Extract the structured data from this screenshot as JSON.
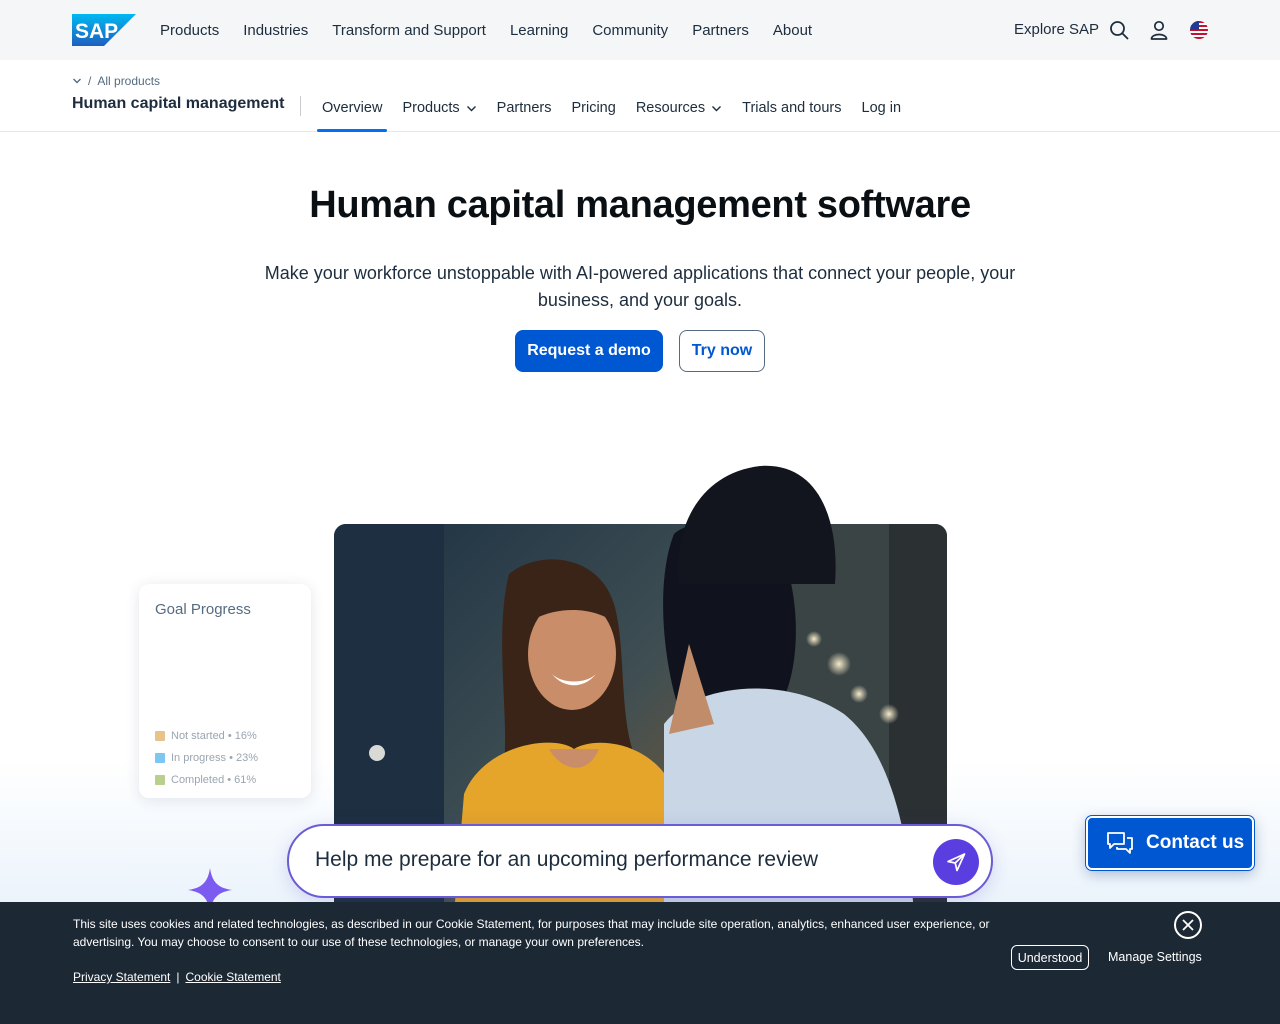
{
  "topnav": {
    "logo": "SAP",
    "links": [
      "Products",
      "Industries",
      "Transform and Support",
      "Learning",
      "Community",
      "Partners",
      "About"
    ],
    "explore": "Explore SAP",
    "icons": [
      "search-icon",
      "user-icon",
      "us-flag-icon"
    ]
  },
  "subnav": {
    "breadcrumb": "All products",
    "breadcrumb_sep": "/",
    "title": "Human capital management",
    "items": [
      {
        "label": "Overview",
        "active": true
      },
      {
        "label": "Products",
        "dropdown": true
      },
      {
        "label": "Partners"
      },
      {
        "label": "Pricing"
      },
      {
        "label": "Resources",
        "dropdown": true
      },
      {
        "label": "Trials and tours"
      },
      {
        "label": "Log in"
      }
    ]
  },
  "hero": {
    "title": "Human capital management software",
    "subtitle": "Make your workforce unstoppable with AI-powered applications that connect your people, your business, and your goals.",
    "primary_button": "Request a demo",
    "secondary_button": "Try now"
  },
  "goal_card": {
    "title": "Goal Progress",
    "legend": [
      {
        "label": "Not started • 16%",
        "color": "#e8c48a",
        "value": 16
      },
      {
        "label": "In progress • 23%",
        "color": "#7cc6ef",
        "value": 23
      },
      {
        "label": "Completed • 61%",
        "color": "#b9cf8c",
        "value": 61
      }
    ]
  },
  "prompt": {
    "text": "Help me prepare for an upcoming performance review"
  },
  "contact": {
    "label": "Contact us"
  },
  "cookie": {
    "text": "This site uses cookies and related technologies, as described in our Cookie Statement, for purposes that may include site operation, analytics, enhanced user experience, or advertising. You may choose to consent to our use of these technologies, or manage your own preferences.",
    "privacy": "Privacy Statement",
    "separator": "|",
    "cookie_statement": "Cookie Statement",
    "understood": "Understood",
    "manage": "Manage Settings"
  },
  "colors": {
    "brand_blue": "#0057d2",
    "accent_purple": "#5b3ee0",
    "banner_bg": "#1c2833"
  }
}
